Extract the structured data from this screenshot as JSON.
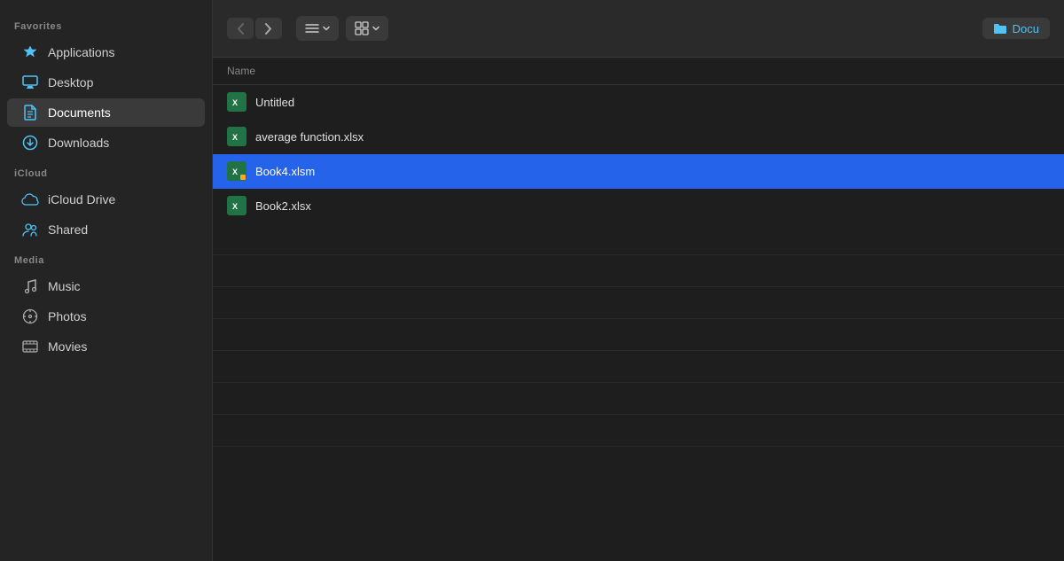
{
  "sidebar": {
    "favorites_label": "Favorites",
    "icloud_label": "iCloud",
    "media_label": "Media",
    "items_favorites": [
      {
        "id": "applications",
        "label": "Applications",
        "icon": "⚡",
        "icon_class": "icon-applications",
        "active": false
      },
      {
        "id": "desktop",
        "label": "Desktop",
        "icon": "🖥",
        "icon_class": "icon-desktop",
        "active": false
      },
      {
        "id": "documents",
        "label": "Documents",
        "icon": "📄",
        "icon_class": "icon-documents",
        "active": true
      },
      {
        "id": "downloads",
        "label": "Downloads",
        "icon": "⬇",
        "icon_class": "icon-downloads",
        "active": false
      }
    ],
    "items_icloud": [
      {
        "id": "icloud-drive",
        "label": "iCloud Drive",
        "icon": "☁",
        "icon_class": "icon-icloud",
        "active": false
      },
      {
        "id": "shared",
        "label": "Shared",
        "icon": "👥",
        "icon_class": "icon-shared",
        "active": false
      }
    ],
    "items_media": [
      {
        "id": "music",
        "label": "Music",
        "icon": "♪",
        "icon_class": "icon-music",
        "active": false
      },
      {
        "id": "photos",
        "label": "Photos",
        "icon": "⊙",
        "icon_class": "icon-photos",
        "active": false
      },
      {
        "id": "movies",
        "label": "Movies",
        "icon": "⊞",
        "icon_class": "icon-movies",
        "active": false
      }
    ]
  },
  "toolbar": {
    "back_label": "‹",
    "forward_label": "›",
    "list_view_label": "≡",
    "grid_view_label": "⊞",
    "chevron_label": "∨",
    "breadcrumb_label": "Docu"
  },
  "file_list": {
    "column_name": "Name",
    "files": [
      {
        "id": "untitled",
        "name": "Untitled",
        "type": "xlsx",
        "selected": false
      },
      {
        "id": "average-function",
        "name": "average function.xlsx",
        "type": "xlsx",
        "selected": false
      },
      {
        "id": "book4",
        "name": "Book4.xlsm",
        "type": "xlsm",
        "selected": true
      },
      {
        "id": "book2",
        "name": "Book2.xlsx",
        "type": "xlsx",
        "selected": false
      }
    ]
  }
}
